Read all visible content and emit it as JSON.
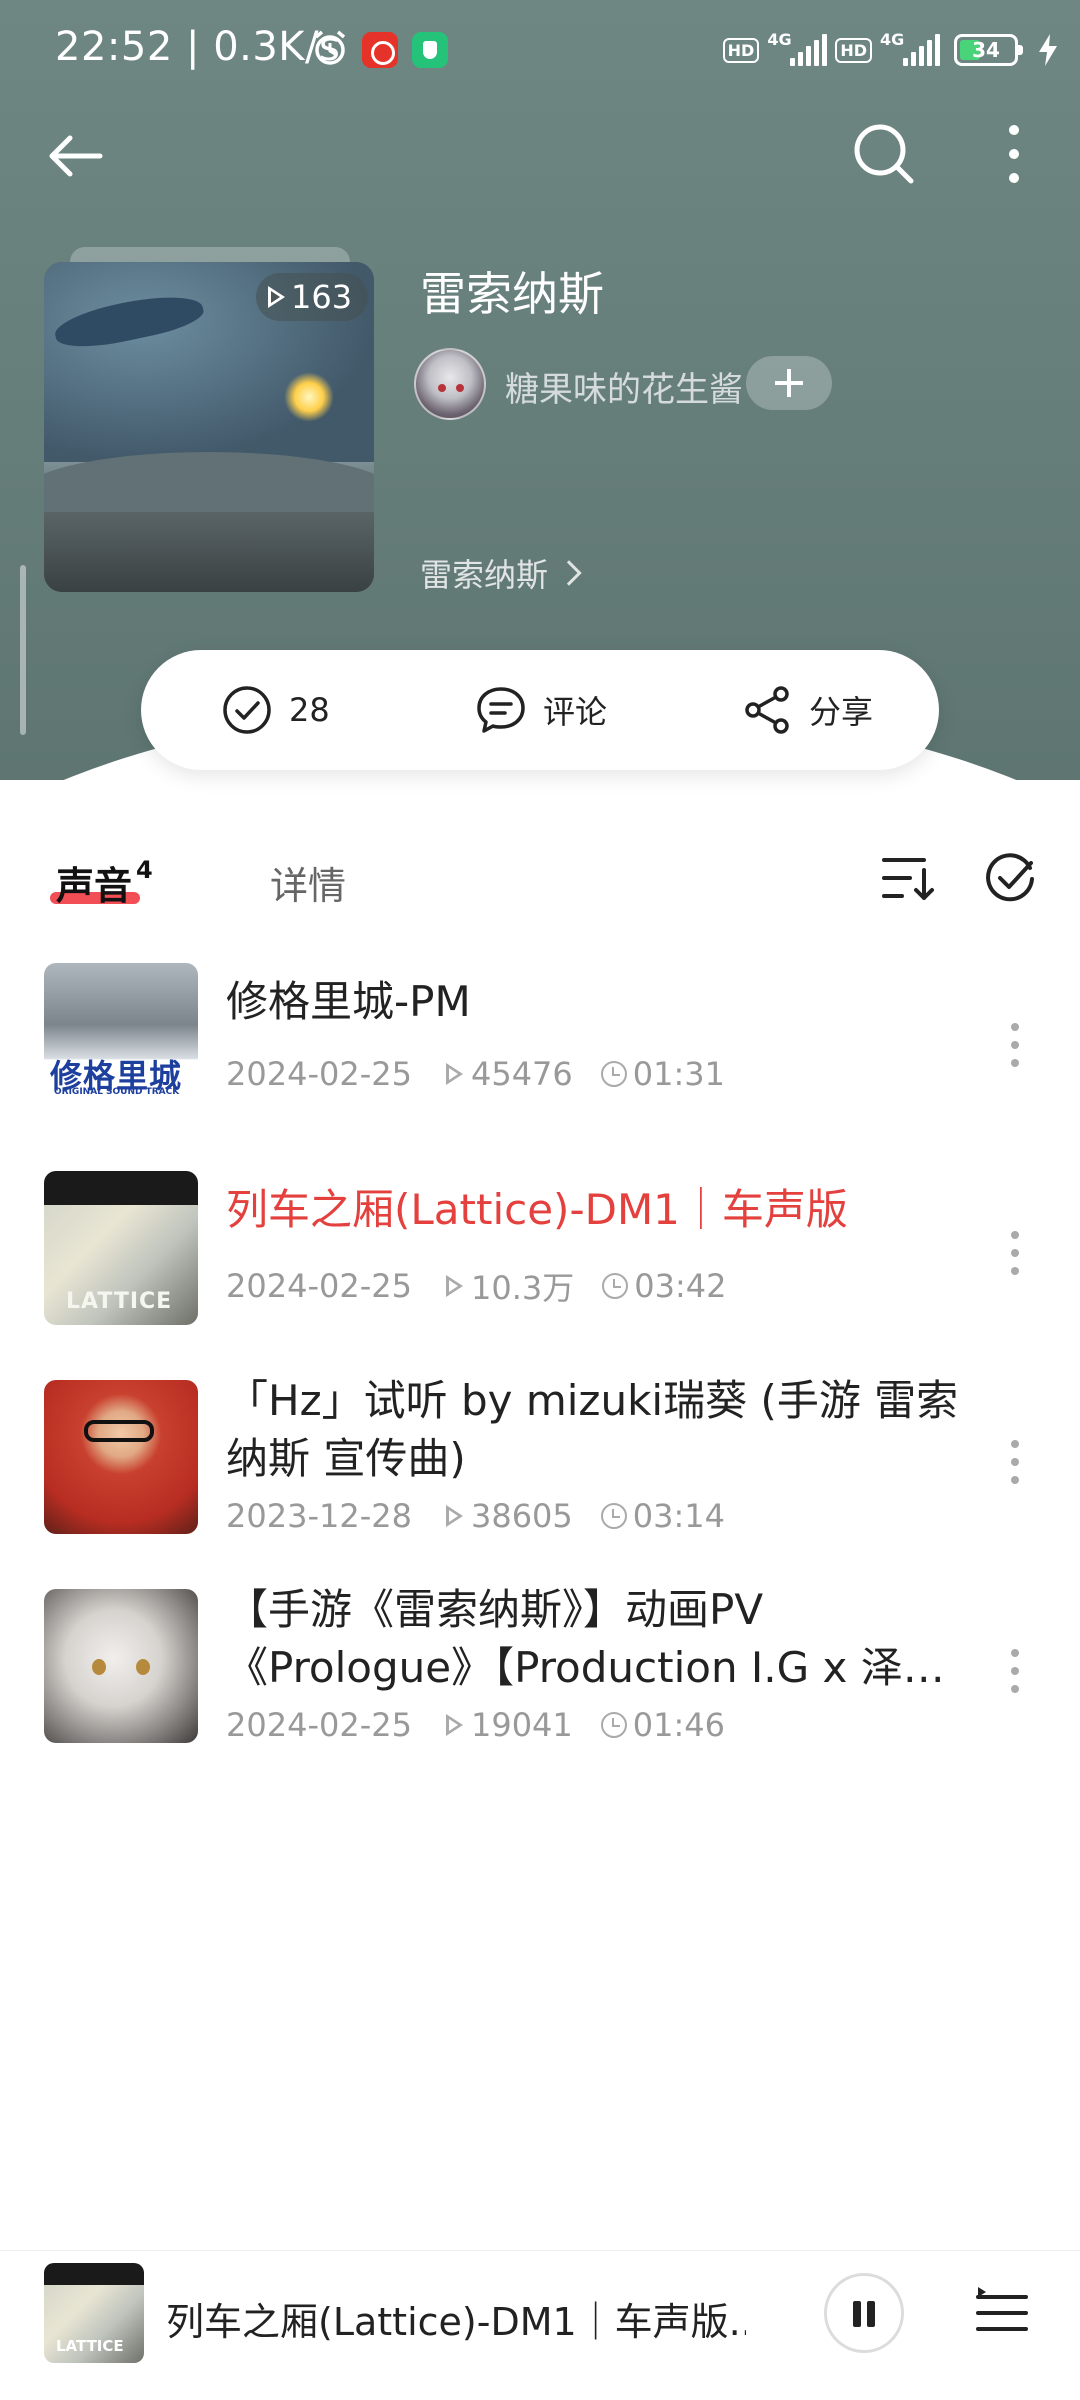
{
  "status_bar": {
    "time": "22:52",
    "speed": "0.3K/s",
    "network1": "4G",
    "network2": "4G",
    "hd": "HD",
    "battery": "34"
  },
  "album": {
    "title": "雷索纳斯",
    "play_count": "163",
    "author": "糖果味的花生酱",
    "series_link": "雷索纳斯"
  },
  "actions": {
    "subscribe_count": "28",
    "comment_label": "评论",
    "share_label": "分享"
  },
  "tabs": {
    "sounds_label": "声音",
    "sounds_count": "4",
    "detail_label": "详情"
  },
  "tracks": [
    {
      "title": "修格里城-PM",
      "date": "2024-02-25",
      "plays": "45476",
      "duration": "01:31",
      "playing": false,
      "thumb_text": "修格里城",
      "thumb_sub": "ORIGINAL SOUND TRACK"
    },
    {
      "title": "列车之厢(Lattice)-DM1｜车声版",
      "date": "2024-02-25",
      "plays": "10.3万",
      "duration": "03:42",
      "playing": true,
      "thumb_text": "LATTICE"
    },
    {
      "title": "「Hz」试听 by mizuki瑞葵 (手游 雷索纳斯 宣传曲)",
      "date": "2023-12-28",
      "plays": "38605",
      "duration": "03:14",
      "playing": false
    },
    {
      "title": "【手游《雷索纳斯》】动画PV《Prologue》【Production I.G x 泽…",
      "date": "2024-02-25",
      "plays": "19041",
      "duration": "01:46",
      "playing": false
    }
  ],
  "mini_player": {
    "title": "列车之厢(Lattice)-DM1｜车声版...",
    "thumb_text": "LATTICE"
  },
  "colors": {
    "header": "#667e7a",
    "accent": "#e3403e",
    "tab_underline": "#ef3b43"
  },
  "icons": [
    "back-arrow-icon",
    "search-icon",
    "more-vertical-icon",
    "check-circle-icon",
    "comment-icon",
    "share-icon",
    "sort-icon",
    "multi-select-icon",
    "pause-icon",
    "playlist-icon"
  ]
}
